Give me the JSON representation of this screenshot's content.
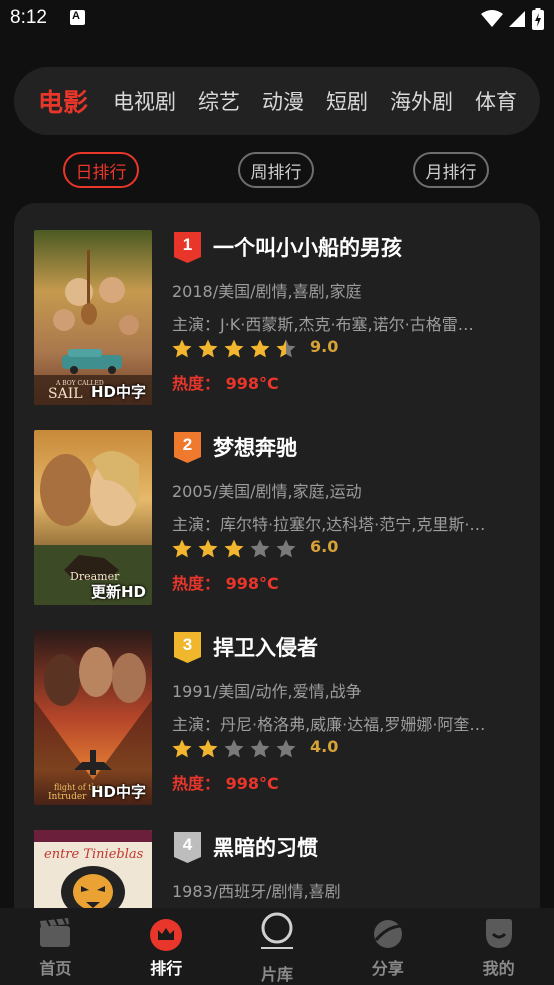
{
  "status": {
    "time": "8:12"
  },
  "categories": [
    "电影",
    "电视剧",
    "综艺",
    "动漫",
    "短剧",
    "海外剧",
    "体育"
  ],
  "periods": [
    "日排行",
    "周排行",
    "月排行"
  ],
  "movies": [
    {
      "rank": "1",
      "title": "一个叫小小船的男孩",
      "meta": "2018/美国/剧情,喜剧,家庭",
      "cast": "主演：J·K·西蒙斯,杰克·布塞,诺尔·古格雷…",
      "rating": "9.0",
      "rating_value": 4.5,
      "heat": "热度：  998°C",
      "badge": "HD中字",
      "rank_color": "#e8362b"
    },
    {
      "rank": "2",
      "title": "梦想奔驰",
      "meta": "2005/美国/剧情,家庭,运动",
      "cast": "主演：库尔特·拉塞尔,达科塔·范宁,克里斯·…",
      "rating": "6.0",
      "rating_value": 3,
      "heat": "热度：  998°C",
      "badge": "更新HD",
      "rank_color": "#ef7a2e"
    },
    {
      "rank": "3",
      "title": "捍卫入侵者",
      "meta": "1991/美国/动作,爱情,战争",
      "cast": "主演：丹尼·格洛弗,威廉·达福,罗姗娜·阿奎…",
      "rating": "4.0",
      "rating_value": 2,
      "heat": "热度：  998°C",
      "badge": "HD中字",
      "rank_color": "#f0b62c"
    },
    {
      "rank": "4",
      "title": "黑暗的习惯",
      "meta": "1983/西班牙/剧情,喜剧",
      "cast": "",
      "rating": "",
      "rating_value": 0,
      "heat": "",
      "badge": "",
      "rank_color": "#bdbdbd"
    }
  ],
  "nav": [
    "首页",
    "排行",
    "片库",
    "分享",
    "我的"
  ],
  "colors": {
    "accent": "#e8362b",
    "star": "#f2b530",
    "star_empty": "#7a7a7a"
  }
}
